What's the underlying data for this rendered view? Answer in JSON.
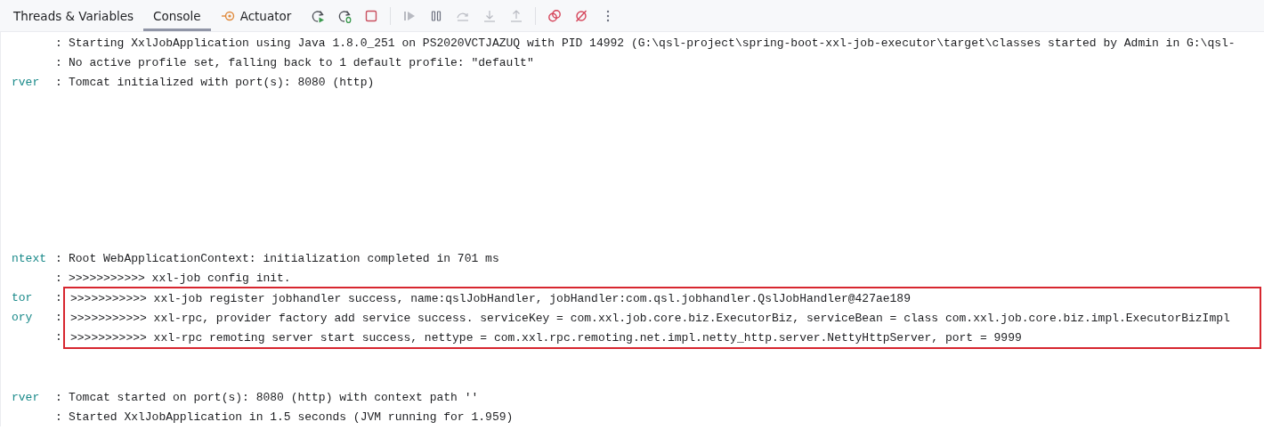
{
  "tabs": [
    {
      "label": "Threads & Variables",
      "selected": false
    },
    {
      "label": "Console",
      "selected": true
    },
    {
      "label": "Actuator",
      "selected": false,
      "kind": "actuator"
    }
  ],
  "toolbar": [
    {
      "kind": "rerun",
      "disabled": false
    },
    {
      "kind": "rerun-debug",
      "disabled": false
    },
    {
      "kind": "stop",
      "disabled": false
    },
    {
      "kind": "separator"
    },
    {
      "kind": "resume",
      "disabled": true
    },
    {
      "kind": "pause",
      "disabled": false
    },
    {
      "kind": "step-over",
      "disabled": true
    },
    {
      "kind": "step-into",
      "disabled": true
    },
    {
      "kind": "step-out",
      "disabled": true
    },
    {
      "kind": "separator"
    },
    {
      "kind": "breakpoints",
      "disabled": false
    },
    {
      "kind": "mute",
      "disabled": false
    },
    {
      "kind": "more",
      "disabled": false
    }
  ],
  "console_lines": [
    {
      "kind": "line",
      "sep": ":",
      "message": "Starting XxlJobApplication using Java 1.8.0_251 on PS2020VCTJAZUQ with PID 14992 (G:\\qsl-project\\spring-boot-xxl-job-executor\\target\\classes started by Admin in G:\\qsl-",
      "highlighted": false
    },
    {
      "kind": "line",
      "sep": ":",
      "message": "No active profile set, falling back to 1 default profile: \"default\"",
      "highlighted": false
    },
    {
      "kind": "line",
      "logger": "rver",
      "sep": ":",
      "message": "Tomcat initialized with port(s): 8080 (http)",
      "highlighted": false
    },
    {
      "kind": "blank"
    },
    {
      "kind": "blank"
    },
    {
      "kind": "blank"
    },
    {
      "kind": "blank"
    },
    {
      "kind": "blank"
    },
    {
      "kind": "blank"
    },
    {
      "kind": "blank"
    },
    {
      "kind": "blank"
    },
    {
      "kind": "line",
      "logger": "ntext",
      "sep": ":",
      "message": "Root WebApplicationContext: initialization completed in 701 ms",
      "highlighted": false
    },
    {
      "kind": "line",
      "sep": ":",
      "message": ">>>>>>>>>>> xxl-job config init.",
      "highlighted": false
    },
    {
      "kind": "line",
      "logger": "tor",
      "sep": ":",
      "message": ">>>>>>>>>>> xxl-job register jobhandler success, name:qslJobHandler, jobHandler:com.qsl.jobhandler.QslJobHandler@427ae189",
      "highlighted": true
    },
    {
      "kind": "line",
      "logger": "ory",
      "sep": ":",
      "message": ">>>>>>>>>>> xxl-rpc, provider factory add service success. serviceKey = com.xxl.job.core.biz.ExecutorBiz, serviceBean = class com.xxl.job.core.biz.impl.ExecutorBizImpl",
      "highlighted": true
    },
    {
      "kind": "line",
      "sep": ":",
      "message": ">>>>>>>>>>> xxl-rpc remoting server start success, nettype = com.xxl.rpc.remoting.net.impl.netty_http.server.NettyHttpServer, port = 9999",
      "highlighted": true
    },
    {
      "kind": "blank"
    },
    {
      "kind": "blank"
    },
    {
      "kind": "line",
      "logger": "rver",
      "sep": ":",
      "message": "Tomcat started on port(s): 8080 (http) with context path ''",
      "highlighted": false
    },
    {
      "kind": "line",
      "sep": ":",
      "message": "Started XxlJobApplication in 1.5 seconds (JVM running for 1.959)",
      "highlighted": false
    }
  ]
}
